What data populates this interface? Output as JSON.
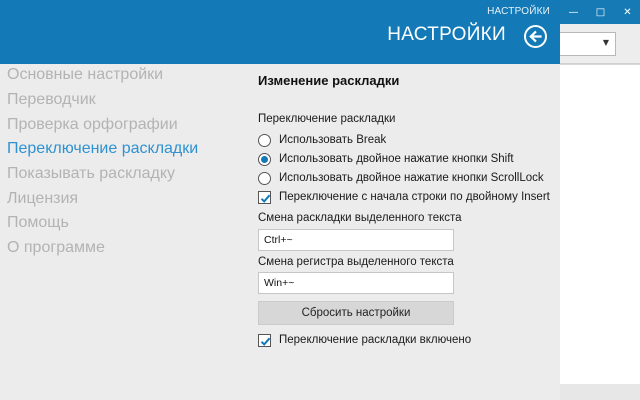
{
  "header": {
    "small_title": "НАСТРОЙКИ",
    "title": "НАСТРОЙКИ",
    "back_icon": "arrow-left-circle-icon"
  },
  "window_controls": {
    "minimize": "—",
    "maximize": "□",
    "close": "✕"
  },
  "nav": {
    "items": [
      {
        "label": "Основные настройки",
        "active": false
      },
      {
        "label": "Переводчик",
        "active": false
      },
      {
        "label": "Проверка орфографии",
        "active": false
      },
      {
        "label": "Переключение раскладки",
        "active": true
      },
      {
        "label": "Показывать раскладку",
        "active": false
      },
      {
        "label": "Лицензия",
        "active": false
      },
      {
        "label": "Помощь",
        "active": false
      },
      {
        "label": "О программе",
        "active": false
      }
    ]
  },
  "main": {
    "section_title": "Изменение раскладки",
    "switch_group_label": "Переключение раскладки",
    "radios": [
      {
        "label": "Использовать Break",
        "checked": false
      },
      {
        "label": "Использовать двойное нажатие кнопки Shift",
        "checked": true
      },
      {
        "label": "Использовать двойное нажатие кнопки ScrollLock",
        "checked": false
      }
    ],
    "insert_checkbox": {
      "label": "Переключение с начала строки по двойному Insert",
      "checked": true
    },
    "selected_layout_label": "Смена раскладки выделенного текста",
    "selected_layout_value": "Ctrl+~",
    "selected_case_label": "Смена регистра выделенного текста",
    "selected_case_value": "Win+~",
    "reset_button": "Сбросить настройки",
    "enabled_checkbox": {
      "label": "Переключение раскладки включено",
      "checked": true
    }
  },
  "colors": {
    "accent": "#137ab7",
    "nav_active": "#2e92d1",
    "nav_inactive": "#b3b3b3",
    "panel_bg": "#ececec"
  }
}
